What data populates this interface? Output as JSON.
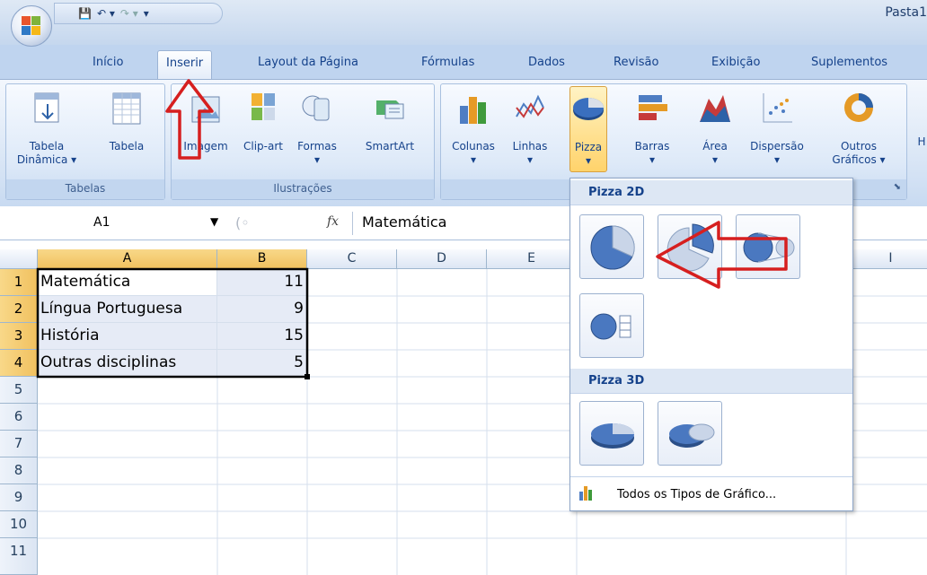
{
  "window": {
    "title": "Pasta1"
  },
  "ribbon_tabs": [
    "Início",
    "Inserir",
    "Layout da Página",
    "Fórmulas",
    "Dados",
    "Revisão",
    "Exibição",
    "Suplementos"
  ],
  "active_tab": "Inserir",
  "groups": {
    "tabelas": {
      "label": "Tabelas",
      "buttons": [
        {
          "line1": "Tabela",
          "line2": "Dinâmica ▾"
        },
        {
          "line1": "Tabela",
          "line2": ""
        }
      ]
    },
    "ilustracoes": {
      "label": "Ilustrações",
      "buttons": [
        {
          "line1": "Imagem",
          "line2": ""
        },
        {
          "line1": "Clip-art",
          "line2": ""
        },
        {
          "line1": "Formas",
          "line2": "▾"
        },
        {
          "line1": "SmartArt",
          "line2": ""
        }
      ]
    },
    "graficos": {
      "label": "",
      "buttons": [
        {
          "line1": "Colunas",
          "line2": "▾"
        },
        {
          "line1": "Linhas",
          "line2": "▾"
        },
        {
          "line1": "Pizza",
          "line2": "▾"
        },
        {
          "line1": "Barras",
          "line2": "▾"
        },
        {
          "line1": "Área",
          "line2": "▾"
        },
        {
          "line1": "Dispersão",
          "line2": "▾"
        },
        {
          "line1": "Outros",
          "line2": "Gráficos ▾"
        }
      ]
    },
    "next_letter": "H"
  },
  "formula_bar": {
    "name_box": "A1",
    "fx": "fx",
    "value": "Matemática"
  },
  "columns": [
    "A",
    "B",
    "C",
    "D",
    "E",
    "I"
  ],
  "rows": [
    "1",
    "2",
    "3",
    "4",
    "5",
    "6",
    "7",
    "8",
    "9",
    "10",
    "11"
  ],
  "cells": [
    {
      "a": "Matemática",
      "b": "11"
    },
    {
      "a": "Língua Portuguesa",
      "b": "9"
    },
    {
      "a": "História",
      "b": "15"
    },
    {
      "a": "Outras disciplinas",
      "b": "5"
    }
  ],
  "dropdown": {
    "section_2d": "Pizza 2D",
    "section_3d": "Pizza 3D",
    "footer": "Todos os Tipos de Gráfico..."
  },
  "colors": {
    "highlight": "#ffd36b",
    "annotation_arrow": "#d61f1f",
    "ribbon_blue": "#bfd4ef"
  }
}
